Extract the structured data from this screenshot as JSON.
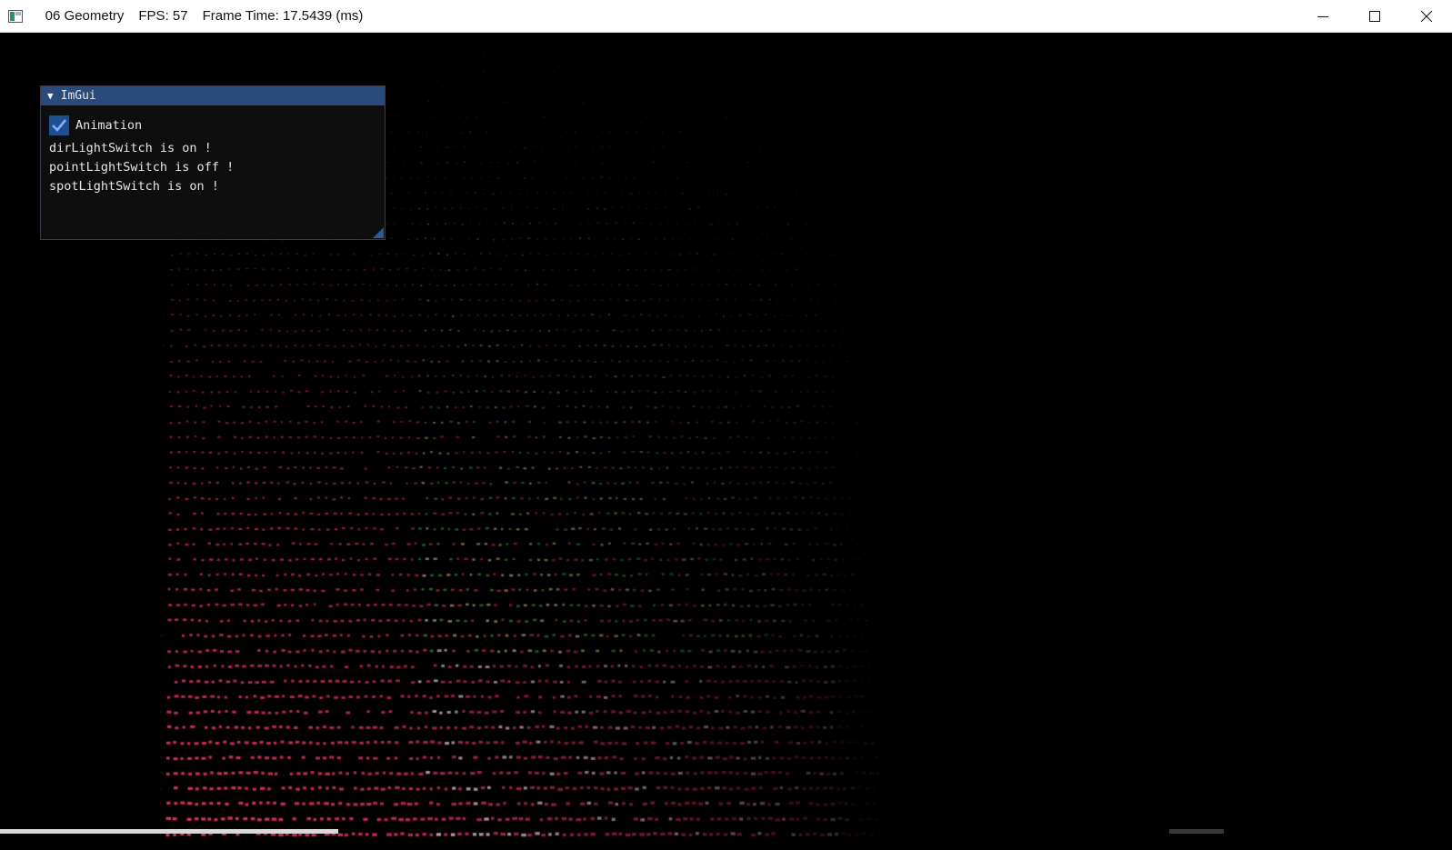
{
  "window": {
    "title": "06 Geometry",
    "fps": "FPS: 57",
    "frame_time": "Frame Time: 17.5439 (ms)",
    "icon": "app-window-icon",
    "controls": [
      "minimize-icon",
      "maximize-icon",
      "close-icon"
    ]
  },
  "imgui": {
    "title": "ImGui",
    "collapse_icon": "collapse-arrow-icon",
    "animation_label": "Animation",
    "animation_checked": true,
    "lines": [
      "dirLightSwitch is on !",
      "pointLightSwitch is off !",
      "spotLightSwitch is on !"
    ]
  },
  "colors": {
    "background": "#000000",
    "geometry_pink": "#e0305a",
    "geometry_green": "#3fa03a",
    "geometry_yellow": "#d8c070",
    "imgui_title": "#294a7a",
    "checkbox": "#1f4f8f"
  }
}
